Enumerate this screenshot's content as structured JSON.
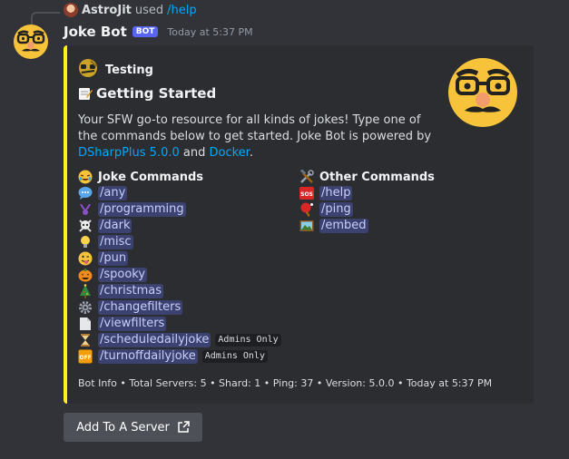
{
  "reply": {
    "user": "AstroJit",
    "verb": "used",
    "command": "/help"
  },
  "message": {
    "bot_name": "Joke Bot",
    "bot_tag": "BOT",
    "timestamp": "Today at 5:37 PM"
  },
  "embed": {
    "accent_color": "#fff21a",
    "author": "Testing",
    "title": "Getting Started",
    "description_text_1": "Your SFW go-to resource for all kinds of jokes! Type one of the commands below to get started. Joke Bot is powered by ",
    "link_1": "DSharpPlus 5.0.0",
    "description_and": " and ",
    "link_2": "Docker",
    "description_end": ".",
    "fields": {
      "joke_commands_title": "Joke Commands",
      "other_commands_title": "Other Commands",
      "joke_commands": [
        {
          "icon": "speech-bubble-icon",
          "cmd": "/any"
        },
        {
          "icon": "fist-icon",
          "cmd": "/programming"
        },
        {
          "icon": "skull-crossbones-icon",
          "cmd": "/dark"
        },
        {
          "icon": "lightbulb-icon",
          "cmd": "/misc"
        },
        {
          "icon": "winking-tongue-icon",
          "cmd": "/pun"
        },
        {
          "icon": "jack-o-lantern-icon",
          "cmd": "/spooky"
        },
        {
          "icon": "christmas-tree-icon",
          "cmd": "/christmas"
        },
        {
          "icon": "gear-icon",
          "cmd": "/changefilters"
        },
        {
          "icon": "page-icon",
          "cmd": "/viewfilters"
        },
        {
          "icon": "hourglass-icon",
          "cmd": "/scheduledailyjoke",
          "badge": "Admins Only"
        },
        {
          "icon": "off-icon",
          "cmd": "/turnoffdailyjoke",
          "badge": "Admins Only"
        }
      ],
      "other_commands": [
        {
          "icon": "sos-icon",
          "cmd": "/help"
        },
        {
          "icon": "ping-pong-icon",
          "cmd": "/ping"
        },
        {
          "icon": "framed-picture-icon",
          "cmd": "/embed"
        }
      ]
    },
    "footer": "Bot Info • Total Servers: 5 • Shard: 1 • Ping: 37 • Version: 5.0.0 • Today at 5:37 PM"
  },
  "button": {
    "label": "Add To A Server",
    "icon": "external-link-icon"
  }
}
